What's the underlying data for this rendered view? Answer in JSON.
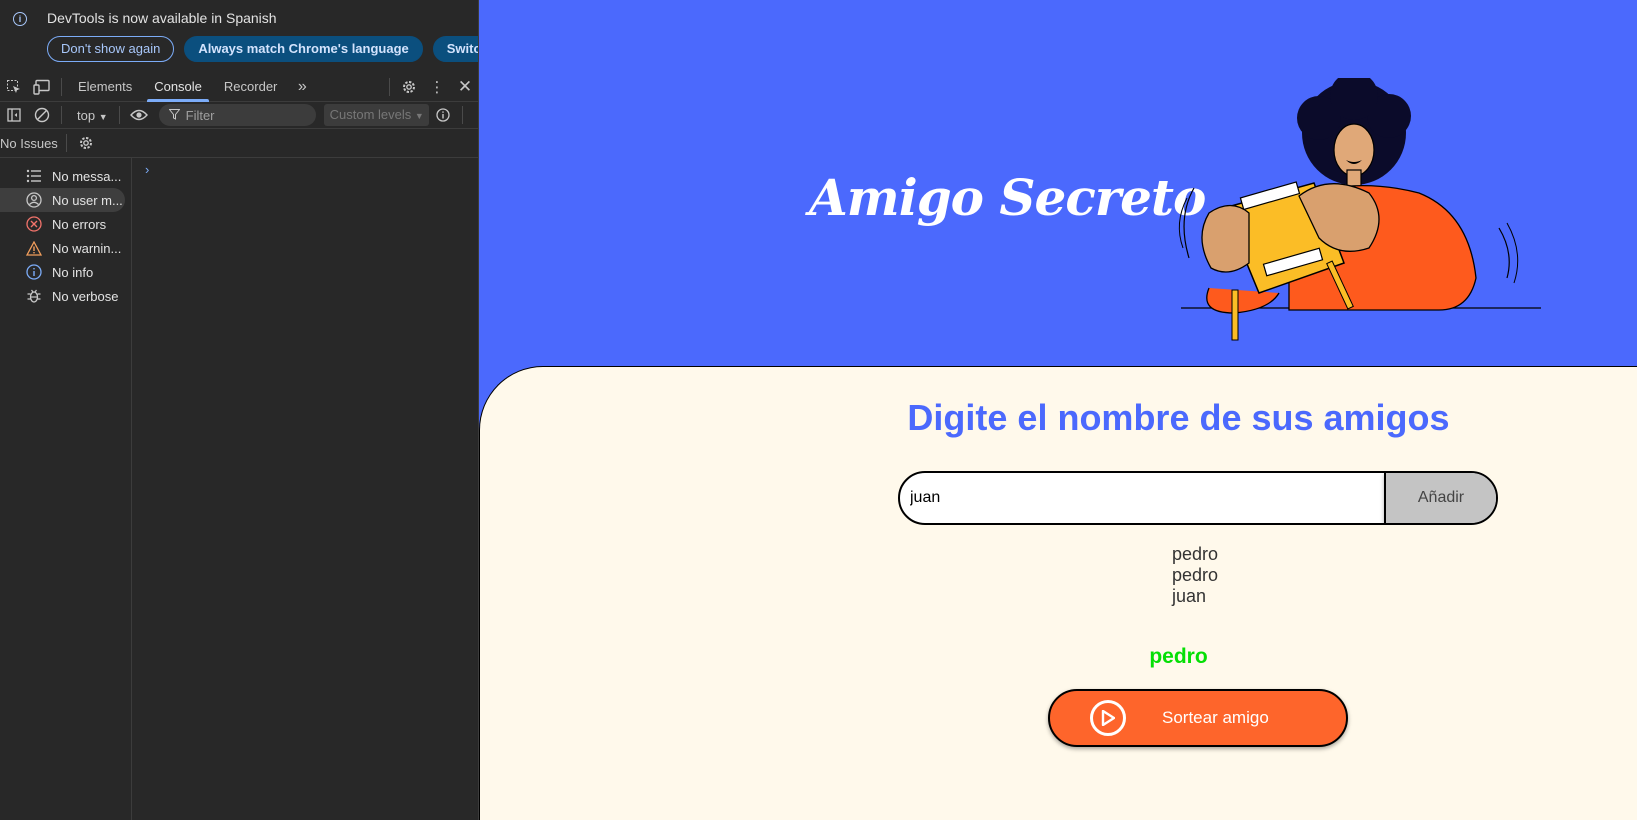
{
  "devtools": {
    "infobar": {
      "message": "DevTools is now available in Spanish",
      "dont_show": "Don't show again",
      "match_language": "Always match Chrome's language",
      "switch": "Switch"
    },
    "tabs": [
      "Elements",
      "Console",
      "Recorder"
    ],
    "active_tab": "Console",
    "context": "top",
    "filter_placeholder": "Filter",
    "levels": "Custom levels",
    "issues": "No Issues",
    "sidebar": [
      {
        "label": "No messa...",
        "icon": "list-icon"
      },
      {
        "label": "No user m...",
        "icon": "user-icon",
        "selected": true
      },
      {
        "label": "No errors",
        "icon": "error-icon"
      },
      {
        "label": "No warnin...",
        "icon": "warning-icon"
      },
      {
        "label": "No info",
        "icon": "info-icon"
      },
      {
        "label": "No verbose",
        "icon": "bug-icon"
      }
    ]
  },
  "page": {
    "title": "Amigo Secreto",
    "heading": "Digite el nombre de sus amigos",
    "input_value": "juan",
    "add_label": "Añadir",
    "friends": [
      "pedro",
      "pedro",
      "juan"
    ],
    "result": "pedro",
    "draw_label": "Sortear amigo",
    "colors": {
      "primary": "#4b69fd",
      "secondary": "#fff9eb",
      "accent": "#fe652b",
      "success": "#05df05"
    }
  }
}
